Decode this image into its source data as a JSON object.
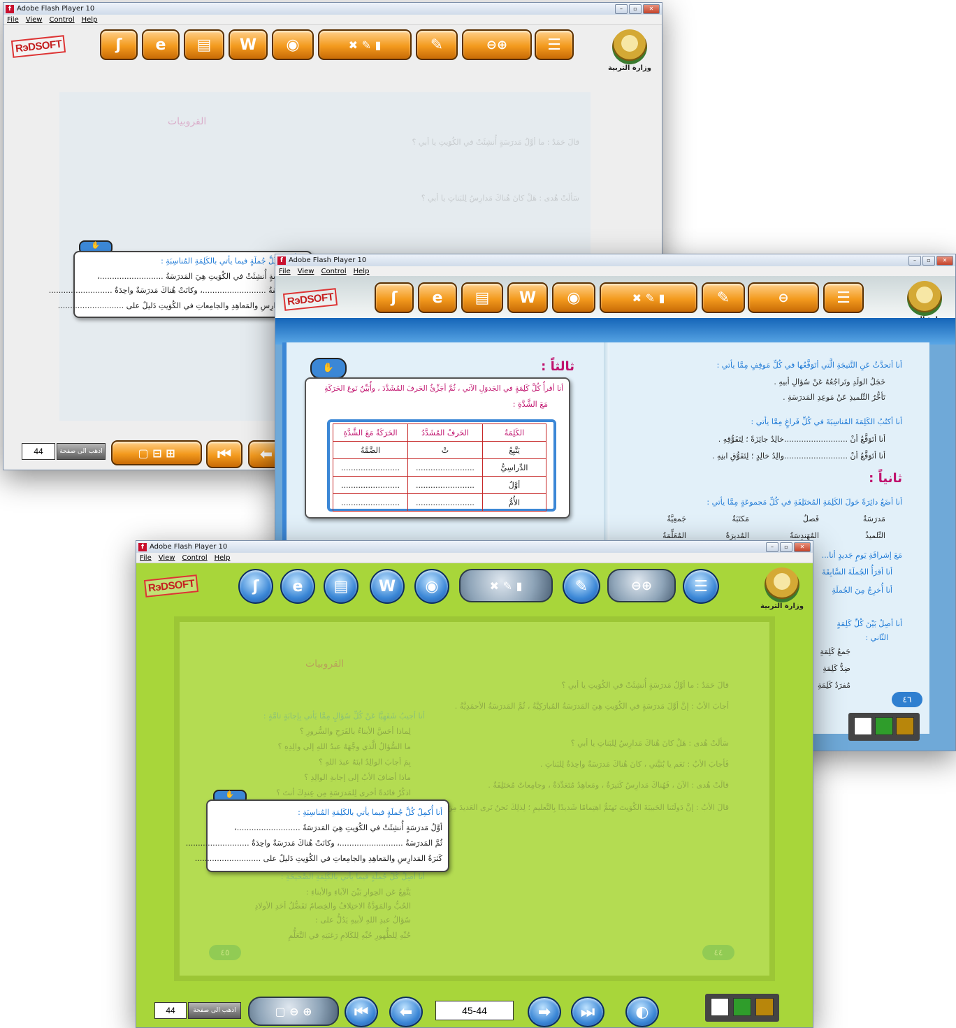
{
  "windows": {
    "title": "Adobe Flash Player 10",
    "menu": [
      "File",
      "View",
      "Control",
      "Help"
    ]
  },
  "brand": {
    "logo_text": "RэDSOFT",
    "ministry_label": "وزارة التربية"
  },
  "icons": {
    "toolbar": [
      "audio-icon",
      "internet-icon",
      "print-icon",
      "word-icon",
      "cd-icon",
      "clear-icon",
      "pen-icon",
      "bookmark-icon",
      "highlight-icon",
      "zoom-out-icon",
      "zoom-in-icon",
      "index-icon"
    ],
    "navigation": [
      "first-page-icon",
      "back-icon",
      "next-icon",
      "last-page-icon",
      "mouse-icon"
    ]
  },
  "colors": {
    "orange_theme": "#f39a1e",
    "blue_theme": "#3b87d6",
    "green_theme": "#a8d63a",
    "swatches": [
      "#ffffff",
      "#2f9d2b",
      "#b8860b"
    ]
  },
  "pager": {
    "page_number_input": "44",
    "go_to_page_label": "اذهب الى صفحة",
    "range_display": "45-44",
    "page_badge_46": "٤٦",
    "page_badge_45": "٤٥",
    "page_badge_44": "٤٤"
  },
  "book_left": {
    "section_title": "القروبيات",
    "q1": "أنا أجيبُ شَفَهِيَّا عَنْ كُلِّ سُؤالٍ مِمَّا يَأتي بِإجابَةٍ تامَّةٍ :",
    "q1_items": [
      "لِماذا أحَسَّ الأبناءُ بالفَرَحِ والسُّرورِ ؟",
      "ما السُّؤالُ الَّذي وجَّهَهُ عبدُ اللهِ إلى والِدِهِ ؟",
      "بِمَ أجابَ الوالِدُ ابنَهُ عبدَ اللهِ ؟",
      "ماذا أضافَ الأبُ إلى إجابةِ الوالِدِ ؟",
      "اذكُرْ فائدةً أخرى لِلمَدرَسَةِ مِن عِندِكَ أنتَ ؟"
    ],
    "q2": "أنا أُكمِلُ كُلَّ جُملَةٍ فيما يأتي بالكَلِمَةِ المُناسِبَةِ :",
    "q2_lines": [
      "أوَّلُ مَدرَسَةٍ أُنشِئَتْ في الكُوَيتِ هِيَ المَدرَسَةُ ..........................،",
      "ثُمَّ المَدرَسَةُ ..........................، وكانَتْ هُناكَ مَدرَسَةٌ واحِدَةٌ ..........................",
      "كَثرَةُ المَدارِسِ والمَعاهِدِ والجامِعاتِ في الكُوَيتِ دَليلٌ على ..........................."
    ],
    "q3": "أنا أصِلُ كُلَّ جُملَةٍ فيما يأتي بالكَلِمَةِ الصَّحيحَةِ :",
    "q3_lines": [
      "يَتَّفِعُ عَن الحِوارِ بَيْنَ الآباءِ والأبناءِ :",
      "الحُبُّ والمَوَدَّةُ     الاختِلافُ والخِصامُ     تَفَضُّلُ أحَدِ الأولادِ",
      "سُؤالُ عبدِ اللهِ لأبيهِ يَدُلُّ على :",
      "حُبِّهِ لِلظُّهورِ     حُبِّهِ لِلكَلامِ     رَغبَتِهِ في التَّعَلُّمِ"
    ]
  },
  "book_right": {
    "paragraphs": [
      "قالَ حَمَدٌ : ما أوَّلُ مَدرَسَةٍ أُنشِئَتْ في الكُوَيتِ يا أبي ؟",
      "أجابَ الأبُ : إنَّ أوَّلَ مَدرَسَةٍ في الكُوَيتِ هِيَ المَدرَسَةُ المُبارَكِيَّةُ ، ثُمَّ المَدرَسَةُ الأحمَدِيَّةُ .",
      "سَألَتْ هُدى : هَلْ كانَ هُناكَ مَدارِسُ لِلبَناتِ يا أبي ؟",
      "فَأجابَ الأبُ : نَعَم يا بُنَيَّتي ، كانَ هُناكَ مَدرَسَةٌ واحِدَةٌ لِلبَناتِ .",
      "قالَتْ هُدى : الآنَ ، فَهُناكَ مَدارِسُ كَثيرَةٌ ، ومَعاهِدُ مُتَعَدِّدَةٌ ، وجامِعاتٌ مُختَلِفَةٌ .",
      "قالَ الأبُ : إنَّ دَولَتَنا الحَبيبَةَ الكُوَيتَ تَهتَمُّ اهتِمامًا شَديدًا بِالتَّعليمِ ؛ لِذلِكَ نَحنُ نَرى العَديدَ مِنَ المَدارِسِ الحَديثَةِ في جَميعِ مَناطِقِ الكُوَيتِ ."
    ]
  },
  "blue_window": {
    "thalithan": "ثالثاً :",
    "thaniyan": "ثانياً :",
    "ex1": "أنا أقرأُ كُلَّ كَلِمَةٍ في الجَدوَلِ الآتي ، ثُمَّ أجَزِّئُ الحَرفَ المُشَدَّدَ ، وأُبَيِّنُ نَوعَ الحَرَكَةِ",
    "ex1_cont": "مَعَ الشَّدَّةِ :",
    "table_headers": [
      "الكَلِمَةُ",
      "الحَرفُ المُشَدَّدُ",
      "الحَرَكَةُ مَعَ الشَّدَّةِ"
    ],
    "table_rows": [
      [
        "يَتَّبِعُ",
        "تْ",
        "الضَّمَّةُ"
      ],
      [
        "الدِّراسِيُّ",
        "........................",
        "........................"
      ],
      [
        "أوَّلُ",
        "........................",
        "........................"
      ],
      [
        "الأُمُّ",
        "........................",
        "........................"
      ]
    ],
    "q4": "أنا أتحدَّثُ عَنِ النَّتيجَةِ الَّتي أتَوَقَّعُها في كُلِّ مَوقِفٍ مِمَّا يأتي :",
    "q4_items": [
      "خَجَلُ الوَلَدِ وتَراجُعُهُ عَنْ سُؤالِ أبيهِ .",
      "تَأخُّرُ التِّلميذِ عَنْ مَوعِدِ المَدرَسَةِ ."
    ],
    "q5": "أنا أكتُبُ الكَلِمَةَ المُناسِبَةَ في كُلِّ فَراغٍ مِمَّا يأتي :",
    "q5_items": [
      "أنا أتَوَقَّعُ أنْ ..........................خالِدٌ جائِزَةً ؛ لِتَفَوُّقِهِ .",
      "أنا أتَوَقَّعُ أنْ ..........................والِدُ خالِدٍ ؛ لِتَفَوُّقِ ابنِهِ ."
    ],
    "q6": "أنا أضَعُ دائِرَةً حَولَ الكَلِمَةِ المُختَلِفَةِ في كُلِّ مَجموعَةٍ مِمَّا يأتي :",
    "q6_row1": [
      "مَدرَسَةٌ",
      "فَصلٌ",
      "مَكتَبَةٌ",
      "جَمعِيَّةٌ"
    ],
    "q6_row2": [
      "التِّلميذُ",
      "المُهَندِسَةُ",
      "المُديرَةُ",
      "المُعَلِّمَةُ"
    ],
    "q7": "مَعَ إشراقَةِ يَومٍ جَديدٍ أنا...",
    "q7_items": [
      "أنا أقرَأُ الجُملَةَ السَّابِقَةَ",
      "أنا أُخرِجُ مِنَ الجُملَةِ"
    ],
    "q8": "أنا أصِلُ بَيْنَ كُلِّ كَلِمَةٍ",
    "q8_sub": "الثّاني :",
    "q8_items": [
      "جَمعُ كَلِمَةِ",
      "ضِدُّ كَلِمَةِ",
      "مُفرَدُ كَلِمَةِ"
    ]
  }
}
